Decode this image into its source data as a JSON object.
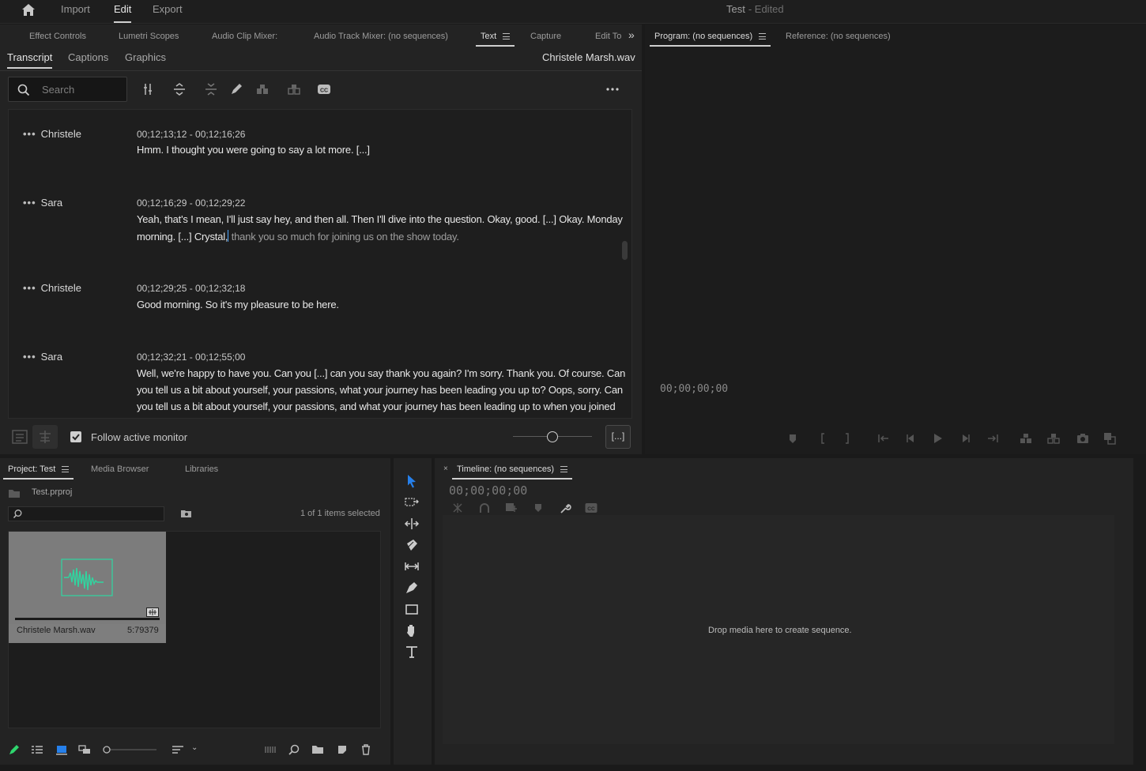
{
  "header": {
    "tabs": [
      "Import",
      "Edit",
      "Export"
    ],
    "active_tab": "Edit",
    "document_title": "Test",
    "document_status": "- Edited"
  },
  "left_panel": {
    "tabs": [
      "Effect Controls",
      "Lumetri Scopes",
      "Audio Clip Mixer:",
      "Audio Track Mixer: (no sequences)",
      "Text",
      "Capture",
      "Edit To"
    ],
    "active_tab": "Text",
    "overflow_icon": "double-chevron-right-icon"
  },
  "text_panel": {
    "subtabs": [
      "Transcript",
      "Captions",
      "Graphics"
    ],
    "active_subtab": "Transcript",
    "clip_name": "Christele Marsh.wav",
    "search_placeholder": "Search",
    "toolbar_icons": [
      "merge-segments-icon",
      "expand-segment-icon",
      "collapse-segment-icon",
      "edit-pencil-icon",
      "cut-segment-icon",
      "split-segment-icon",
      "captions-cc-icon",
      "more-options-icon"
    ],
    "entries": [
      {
        "speaker": "Christele",
        "timecode": "00;12;13;12 - 00;12;16;26",
        "lines": [
          "Hmm. I thought you were going to say a lot more. [...]"
        ]
      },
      {
        "speaker": "Sara",
        "timecode": "00;12;16;29 - 00;12;29;22",
        "lines": [
          "Yeah, that's I mean, I'll just say hey, and then all. Then I'll dive into the question. Okay, good. [...] Okay. Monday",
          "morning. [...] Crystal,",
          " thank you so much for joining us on the show today."
        ]
      },
      {
        "speaker": "Christele",
        "timecode": "00;12;29;25 - 00;12;32;18",
        "lines": [
          "Good morning. So it's my pleasure to be here."
        ]
      },
      {
        "speaker": "Sara",
        "timecode": "00;12;32;21 - 00;12;55;00",
        "lines": [
          "Well, we're happy to have you. Can you [...] can you say thank you again? I'm sorry. Thank you. Of course. Can",
          "you tell us a bit about yourself, your passions, what your journey has been leading you up to? Oops, sorry. Can",
          "you tell us a bit about yourself, your passions, and what your journey has been leading up to when you joined"
        ]
      }
    ],
    "follow_active_monitor_label": "Follow active monitor",
    "follow_active_monitor_checked": true,
    "bracket_button_label": "[...]"
  },
  "program_monitor": {
    "tabs": [
      "Program: (no sequences)",
      "Reference: (no sequences)"
    ],
    "active_tab": "Program: (no sequences)",
    "timecode": "00;00;00;00",
    "transport_icons": [
      "add-marker-icon",
      "mark-in-icon",
      "mark-out-icon",
      "go-to-in-icon",
      "step-back-icon",
      "play-icon",
      "step-forward-icon",
      "go-to-out-icon",
      "lift-icon",
      "extract-icon",
      "export-frame-icon",
      "button-editor-icon"
    ]
  },
  "project_panel": {
    "tabs": [
      "Project: Test",
      "Media Browser",
      "Libraries"
    ],
    "active_tab": "Project: Test",
    "project_file": "Test.prproj",
    "items_selected": "1 of 1 items selected",
    "clip": {
      "name": "Christele Marsh.wav",
      "duration": "5:79379"
    },
    "bottom_icons": [
      "pencil-icon",
      "list-view-icon",
      "icon-view-icon",
      "freeform-view-icon",
      "zoom-slider-icon",
      "sort-icon",
      "automate-sequence-icon",
      "find-icon",
      "new-bin-icon",
      "new-item-icon",
      "trash-icon"
    ]
  },
  "tools": [
    "selection-tool-icon",
    "track-select-icon",
    "ripple-edit-icon",
    "razor-tool-icon",
    "slip-tool-icon",
    "pen-tool-icon",
    "rectangle-tool-icon",
    "hand-tool-icon",
    "type-tool-icon"
  ],
  "timeline": {
    "title": "Timeline: (no sequences)",
    "timecode": "00;00;00;00",
    "drop_text": "Drop media here to create sequence.",
    "icons": [
      "snap-icon",
      "linked-selection-icon",
      "add-marker-icon",
      "marker-icon",
      "settings-wrench-icon",
      "captions-cc-icon"
    ]
  }
}
